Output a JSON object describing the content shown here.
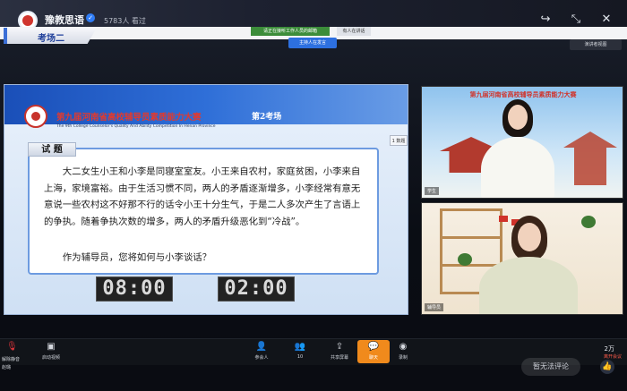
{
  "stream": {
    "channel_name": "豫教思语",
    "viewers": "5783人 看过"
  },
  "meeting": {
    "room_label": "考场二",
    "notice_banner": "请正在接听工作人员的邮箱",
    "speaking_label": "有人在讲话",
    "host_pill": "主持人在发言",
    "gallery_button": "演讲者视图"
  },
  "slide": {
    "title": "第九届河南省高校辅导员素质能力大赛",
    "subtitle": "The 9th College Counselor's Quality And Ability Competition In Henan Province",
    "room": "第2考场",
    "side_tab": "1 数题",
    "question_tag": "试 题",
    "question_body": "大二女生小王和小李是同寝室室友。小王来自农村，家庭贫困，小李来自上海，家境富裕。由于生活习惯不同，两人的矛盾逐渐增多，小李经常有意无意说一些农村这不好那不行的话令小王十分生气，于是二人多次产生了言语上的争执。随着争执次数的增多，两人的矛盾升级恶化到“冷战”。",
    "question_ask": "作为辅导员，您将如何与小李谈话？",
    "timer_left": "08:00",
    "timer_right": "02:00"
  },
  "video_tiles": {
    "top": {
      "banner": "第九届河南省高校辅导员素质能力大赛",
      "label": "学生"
    },
    "bottom": {
      "label": "辅导员"
    }
  },
  "toolbar": {
    "mic_label": "解除静音",
    "host_label": "赵璐",
    "video_label": "启动视频",
    "participants_label": "参会人",
    "participants_count": "10",
    "share_label": "共享屏幕",
    "chat_label": "聊天",
    "record_label": "录制",
    "end_label": "离开会议",
    "like_count": "2万"
  },
  "comment_placeholder": "暂无法评论",
  "icons": {
    "top": [
      "share-icon",
      "collapse-icon",
      "close-icon"
    ],
    "toolbar": [
      "mic-muted-icon",
      "video-icon",
      "participants-icon",
      "share-screen-icon",
      "chat-icon",
      "record-icon"
    ]
  }
}
